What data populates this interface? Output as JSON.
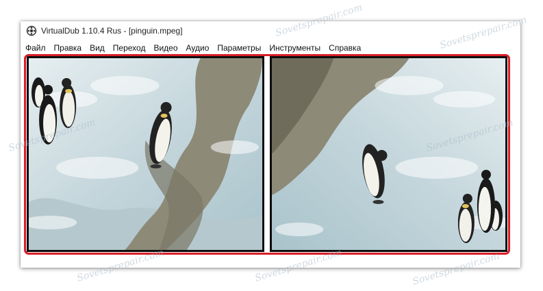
{
  "window": {
    "title": "VirtualDub 1.10.4 Rus - [pinguin.mpeg]",
    "app_icon": "virtualdub-icon"
  },
  "menu": {
    "items": [
      "Файл",
      "Правка",
      "Вид",
      "Переход",
      "Видео",
      "Аудио",
      "Параметры",
      "Инструменты",
      "Справка"
    ]
  },
  "panes": {
    "input_label": "input video pane",
    "output_label": "output video pane"
  },
  "highlight_color": "#d81e28",
  "watermark": "Sovetsprepair.com"
}
